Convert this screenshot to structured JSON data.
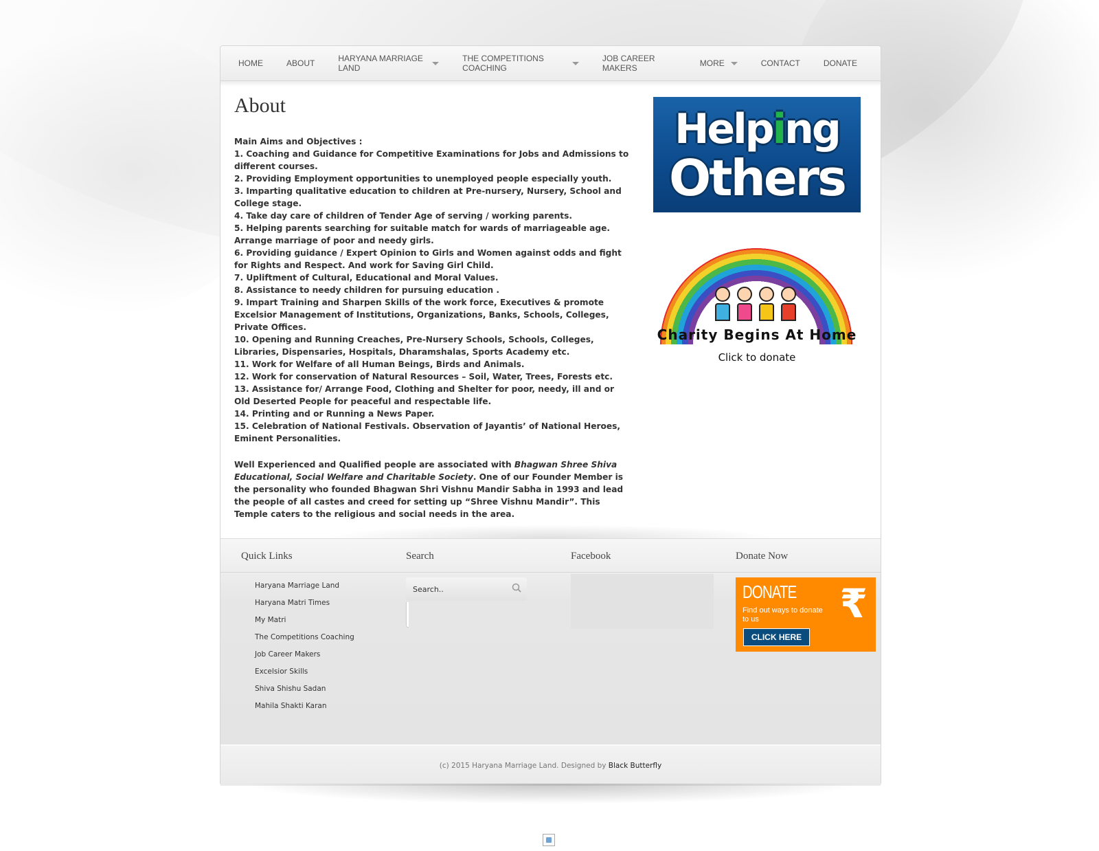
{
  "nav": {
    "items": [
      {
        "label": "HOME",
        "has_dropdown": false
      },
      {
        "label": "ABOUT",
        "has_dropdown": false
      },
      {
        "label": "HARYANA MARRIAGE LAND",
        "has_dropdown": true
      },
      {
        "label": "THE COMPETITIONS COACHING",
        "has_dropdown": true
      },
      {
        "label": "JOB CAREER MAKERS",
        "has_dropdown": false
      },
      {
        "label": "MORE",
        "has_dropdown": true
      },
      {
        "label": "CONTACT",
        "has_dropdown": false
      },
      {
        "label": "DONATE",
        "has_dropdown": false
      }
    ]
  },
  "main": {
    "title": "About",
    "objectives": [
      "Main Aims and Objectives :",
      "1. Coaching and Guidance for Competitive Examinations for Jobs and Admissions to different courses.",
      "2. Providing Employment opportunities to unemployed people especially youth.",
      "3. Imparting qualitative education to children at Pre-nursery, Nursery, School and College stage.",
      "4. Take day care of children of Tender Age of serving / working parents.",
      "5. Helping parents searching for suitable match for wards of marriageable age.",
      "Arrange marriage of poor and needy girls.",
      "6. Providing guidance / Expert Opinion to Girls and Women against odds and fight for Rights and Respect. And work for Saving Girl Child.",
      "7. Upliftment of Cultural, Educational and Moral Values.",
      "8. Assistance to needy children for pursuing education .",
      "9. Impart Training and Sharpen Skills of the work force, Executives & promote Excelsior Management of Institutions, Organizations, Banks, Schools, Colleges, Private Offices.",
      "10. Opening and Running Creaches, Pre-Nursery Schools, Schools, Colleges, Libraries, Dispensaries, Hospitals, Dharamshalas, Sports Academy etc.",
      "11. Work for Welfare of all Human Beings, Birds and Animals.",
      "12. Work for conservation of Natural Resources – Soil, Water, Trees, Forests etc.",
      "13. Assistance for/ Arrange Food, Clothing and Shelter for poor, needy, ill and or Old Deserted People for peaceful and respectable life.",
      "14. Printing and or Running a News Paper.",
      "15. Celebration of National Festivals. Observation of Jayantis’ of National Heroes, Eminent Personalities."
    ],
    "para2_start": "Well Experienced and Qualified people are associated with ",
    "para2_org": "Bhagwan Shree Shiva Educational, Social Welfare and Charitable Society",
    "para2_end": ". One of our Founder Member is the personality who founded Bhagwan Shri Vishnu Mandir Sabha in 1993 and lead the people of all castes and creed for setting up “Shree Vishnu Mandir”. This Temple caters to the religious and social needs in the area."
  },
  "sidebar": {
    "helping_word1_pre": "Help",
    "helping_word1_i": "i",
    "helping_word1_post": "ng",
    "helping_word2": "Others",
    "charity_text": "Charity Begins At Home",
    "click_donate": "Click to donate"
  },
  "footer": {
    "quick_links_title": "Quick Links",
    "quick_links": [
      "Haryana Marriage Land",
      "Haryana Matri Times",
      "My Matri",
      "The Competitions Coaching",
      "Job Career Makers",
      "Excelsior Skills",
      "Shiva Shishu Sadan",
      "Mahila Shakti Karan"
    ],
    "search_title": "Search",
    "search_placeholder": "Search..",
    "facebook_title": "Facebook",
    "donate_title": "Donate Now",
    "donate_banner": {
      "heading": "DONATE",
      "sub": "Find out ways to donate to us",
      "rupee": "₹",
      "button": "CLICK HERE"
    }
  },
  "copyright": {
    "text": "(c) 2015 Haryana Marriage Land. Designed by ",
    "link": "Black Butterfly"
  },
  "colors": {
    "donate_orange": "#ff8a00",
    "helping_blue": "#0c4a8c",
    "helping_green": "#22b24c"
  }
}
